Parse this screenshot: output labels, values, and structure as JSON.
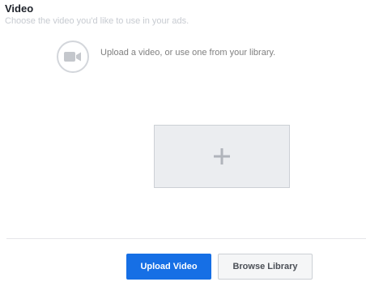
{
  "section": {
    "title": "Video",
    "subtitle": "Choose the video you'd like to use in your ads."
  },
  "upload_prompt": {
    "icon": "video-camera-icon",
    "text": "Upload a video, or use one from your library."
  },
  "add_media": {
    "icon": "plus-icon"
  },
  "actions": {
    "upload_label": "Upload Video",
    "browse_label": "Browse Library"
  },
  "colors": {
    "primary": "#166fe5",
    "icon_gray": "#c4c7cc",
    "placeholder_bg": "#ebedf0"
  }
}
